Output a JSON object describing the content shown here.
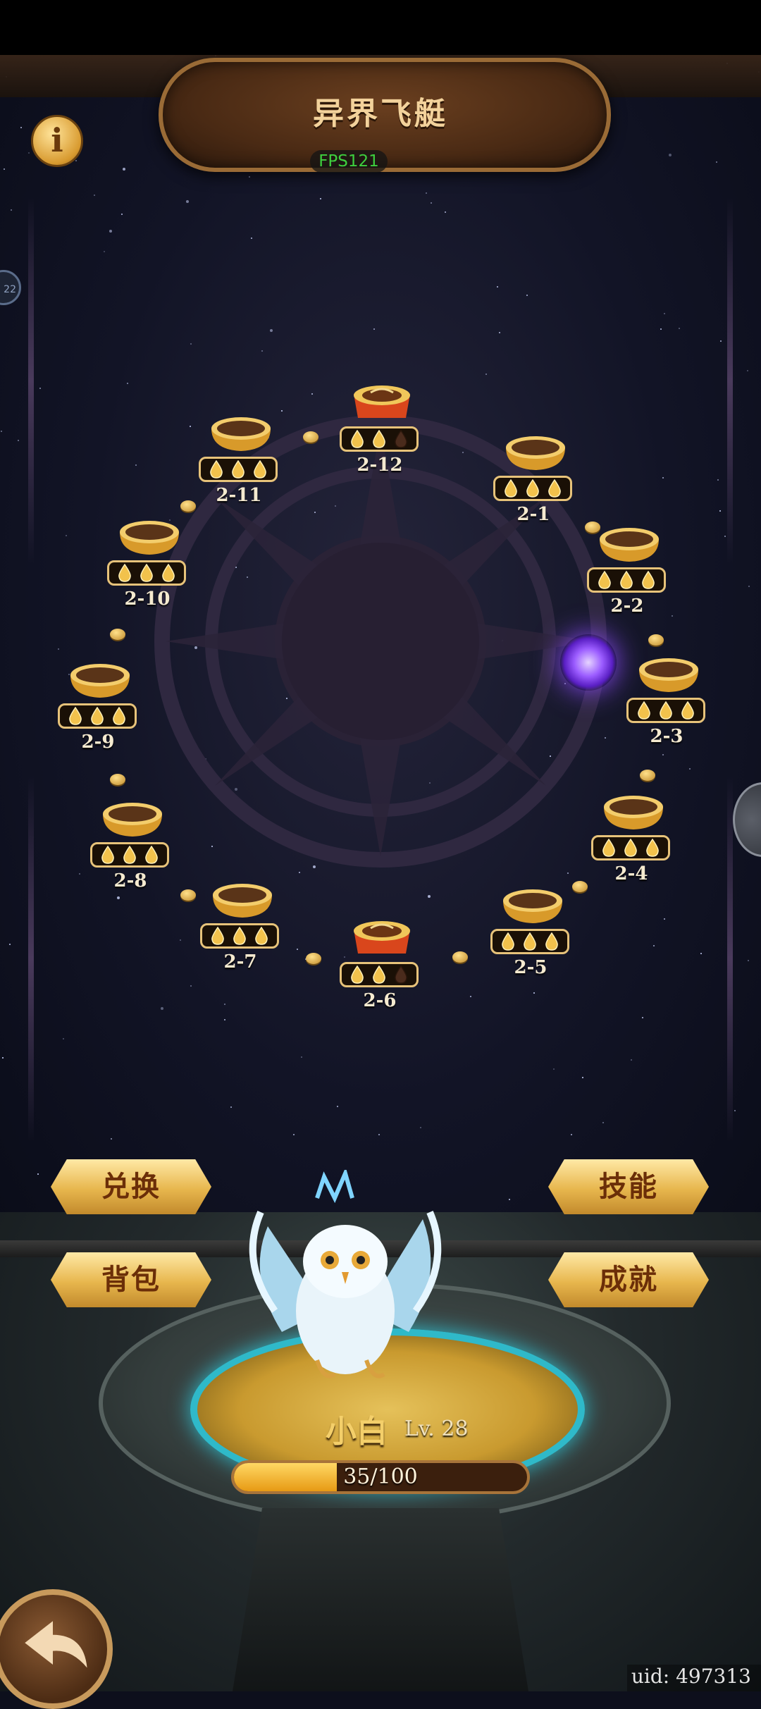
{
  "header": {
    "title": "异界飞艇",
    "fps": "FPS121"
  },
  "side_badge": "22",
  "levels": [
    {
      "label": "2-1",
      "stars": 3,
      "boss": false
    },
    {
      "label": "2-2",
      "stars": 3,
      "boss": false
    },
    {
      "label": "2-3",
      "stars": 3,
      "boss": false
    },
    {
      "label": "2-4",
      "stars": 3,
      "boss": false
    },
    {
      "label": "2-5",
      "stars": 3,
      "boss": false
    },
    {
      "label": "2-6",
      "stars": 2,
      "boss": true
    },
    {
      "label": "2-7",
      "stars": 3,
      "boss": false
    },
    {
      "label": "2-8",
      "stars": 3,
      "boss": false
    },
    {
      "label": "2-9",
      "stars": 3,
      "boss": false
    },
    {
      "label": "2-10",
      "stars": 3,
      "boss": false
    },
    {
      "label": "2-11",
      "stars": 3,
      "boss": false
    },
    {
      "label": "2-12",
      "stars": 2,
      "boss": true
    }
  ],
  "buttons": {
    "exchange": "兑换",
    "skills": "技能",
    "backpack": "背包",
    "achievements": "成就"
  },
  "pet": {
    "name": "小白",
    "level": "Lv. 28",
    "xp_text": "35/100",
    "xp_fraction": 0.35
  },
  "uid": "uid: 497313",
  "colors": {
    "gold": "#e7c37a",
    "portal": "#9b5cff",
    "fps_green": "#3ecf3e"
  },
  "icons": {
    "info": "info-icon",
    "back": "back-arrow-icon"
  }
}
